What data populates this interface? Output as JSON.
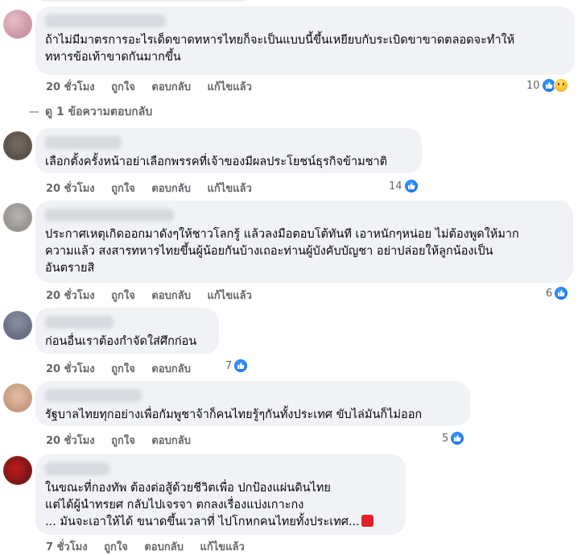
{
  "comments": [
    {
      "text": "ถ้าไม่มีมาตรการอะไรเด็ดขาดทหารไทยก็จะเป็นแบบนี้ขึ้นเหยียบกับระเบิดขาขาดตลอดจะทำให้\nทหารข้อเท้าขาดกันมากขึ้น",
      "time": "20 ชั่วโมง",
      "like": "ถูกใจ",
      "reply": "ตอบกลับ",
      "edited": "แก้ไขแล้ว",
      "reaction_count": "10",
      "reactions": [
        "like-icon",
        "sad-icon"
      ]
    },
    {
      "text": "เลือกตั้งครั้งหน้าอย่าเลือกพรรคที่เจ้าของมีผลประโยชน์ธุรกิจข้ามชาติ",
      "time": "20 ชั่วโมง",
      "like": "ถูกใจ",
      "reply": "ตอบกลับ",
      "edited": "แก้ไขแล้ว",
      "reaction_count": "14",
      "reactions": [
        "like-icon"
      ]
    },
    {
      "text": "ประกาศเหตุเกิดออกมาดังๆให้ชาวโลกรู้ แล้วลงมือตอบโต้ทันที เอาหนักๆหน่อย ไม่ต้องพูดให้มาก\nความแล้ว สงสารทหารไทยขึ้นผู้น้อยกันบ้างเถอะท่านผู้บังคับบัญชา อย่าปล่อยให้ลูกน้องเป็น\nอันตรายสิ",
      "time": "20 ชั่วโมง",
      "like": "ถูกใจ",
      "reply": "ตอบกลับ",
      "edited": "แก้ไขแล้ว",
      "reaction_count": "6",
      "reactions": [
        "like-icon"
      ]
    },
    {
      "text": "ก่อนอื่นเราต้องกำจัดใส่ศึกก่อน",
      "time": "20 ชั่วโมง",
      "like": "ถูกใจ",
      "reply": "ตอบกลับ",
      "reaction_count": "7",
      "reactions": [
        "like-icon"
      ]
    },
    {
      "text": "รัฐบาลไทยทุกอย่างเพื่อกัมพูชาจ้าก็คนไทยรู้ๆกันทั้งประเทศ ขับไล่มันก็ไม่ออก",
      "time": "20 ชั่วโมง",
      "like": "ถูกใจ",
      "reply": "ตอบกลับ",
      "reaction_count": "5",
      "reactions": [
        "like-icon"
      ]
    },
    {
      "text": "ในขณะที่กองทัพ ต้องต่อสู้ด้วยชีวิตเพื่อ ปกป้องแผ่นดินไทย\nแต่ได้ผู้นำทรยศ กลับไปเจรจา ตกลงเรื่องแบ่งเกาะกง\n... มันจะเอาให้ได้ ขนาดขึ้นเวลาที่ ไปโกหกคนไทยทั้งประเทศ...",
      "time": "7 ชั่วโมง",
      "like": "ถูกใจ",
      "reply": "ตอบกลับ",
      "edited": "แก้ไขแล้ว"
    }
  ],
  "view_replies": "ดู 1 ข้อความตอบกลับ",
  "colors": {
    "bubble": "#f0f2f5",
    "meta": "#65676b",
    "like_blue": "#1877f2"
  }
}
